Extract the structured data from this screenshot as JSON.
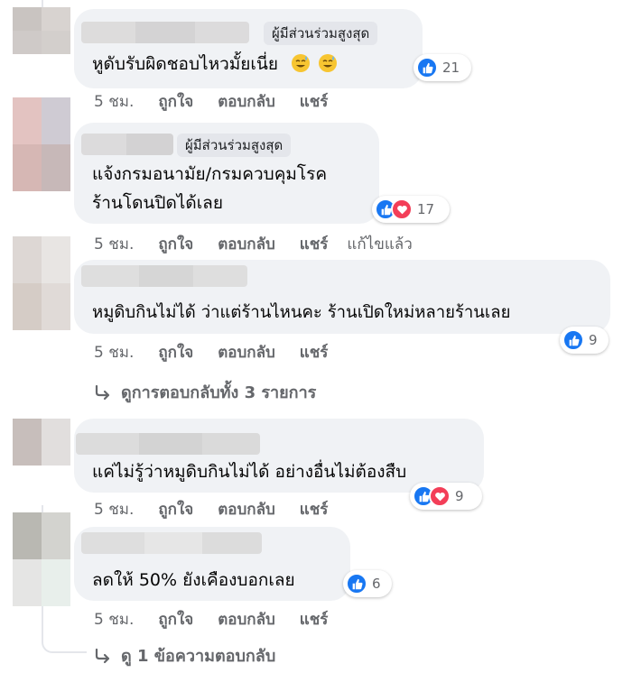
{
  "comments": [
    {
      "badge": "ผู้มีส่วนร่วมสูงสุด",
      "text_lines": [
        "หูดับรับผิดชอบไหวมั้ยเนี่ย"
      ],
      "emojis": [
        "sweat-smile-emoji",
        "sweat-smile-emoji"
      ],
      "reactions": {
        "types": [
          "like"
        ],
        "count": "21"
      },
      "time": "5 ชม.",
      "actions": [
        "ถูกใจ",
        "ตอบกลับ",
        "แชร์"
      ]
    },
    {
      "badge": "ผู้มีส่วนร่วมสูงสุด",
      "text_lines": [
        "แจ้งกรมอนามัย/กรมควบคุมโรค",
        "ร้านโดนปิดได้เลย"
      ],
      "reactions": {
        "types": [
          "like",
          "love"
        ],
        "count": "17"
      },
      "time": "5 ชม.",
      "actions": [
        "ถูกใจ",
        "ตอบกลับ",
        "แชร์"
      ],
      "edited": "แก้ไขแล้ว"
    },
    {
      "text_lines": [
        "หมูดิบกินไม่ได้ ว่าแต่ร้านไหนคะ ร้านเปิดใหม่หลายร้านเลย"
      ],
      "reactions": {
        "types": [
          "like"
        ],
        "count": "9"
      },
      "time": "5 ชม.",
      "actions": [
        "ถูกใจ",
        "ตอบกลับ",
        "แชร์"
      ],
      "more_replies": "ดูการตอบกลับทั้ง 3 รายการ"
    },
    {
      "text_lines": [
        "แค่ไม่รู้ว่าหมูดิบกินไม่ได้ อย่างอื่นไม่ต้องสืบ"
      ],
      "reactions": {
        "types": [
          "like",
          "love"
        ],
        "count": "9"
      },
      "time": "5 ชม.",
      "actions": [
        "ถูกใจ",
        "ตอบกลับ",
        "แชร์"
      ]
    },
    {
      "text_lines": [
        "ลดให้ 50% ยังเคืองบอกเลย"
      ],
      "reactions": {
        "types": [
          "like"
        ],
        "count": "6"
      },
      "time": "5 ชม.",
      "actions": [
        "ถูกใจ",
        "ตอบกลับ",
        "แชร์"
      ],
      "more_replies": "ดู 1 ข้อความตอบกลับ"
    }
  ],
  "colors": {
    "like": "#1877f2",
    "love": "#f33e58",
    "bubble": "#f0f2f5",
    "muted": "#65676b"
  }
}
